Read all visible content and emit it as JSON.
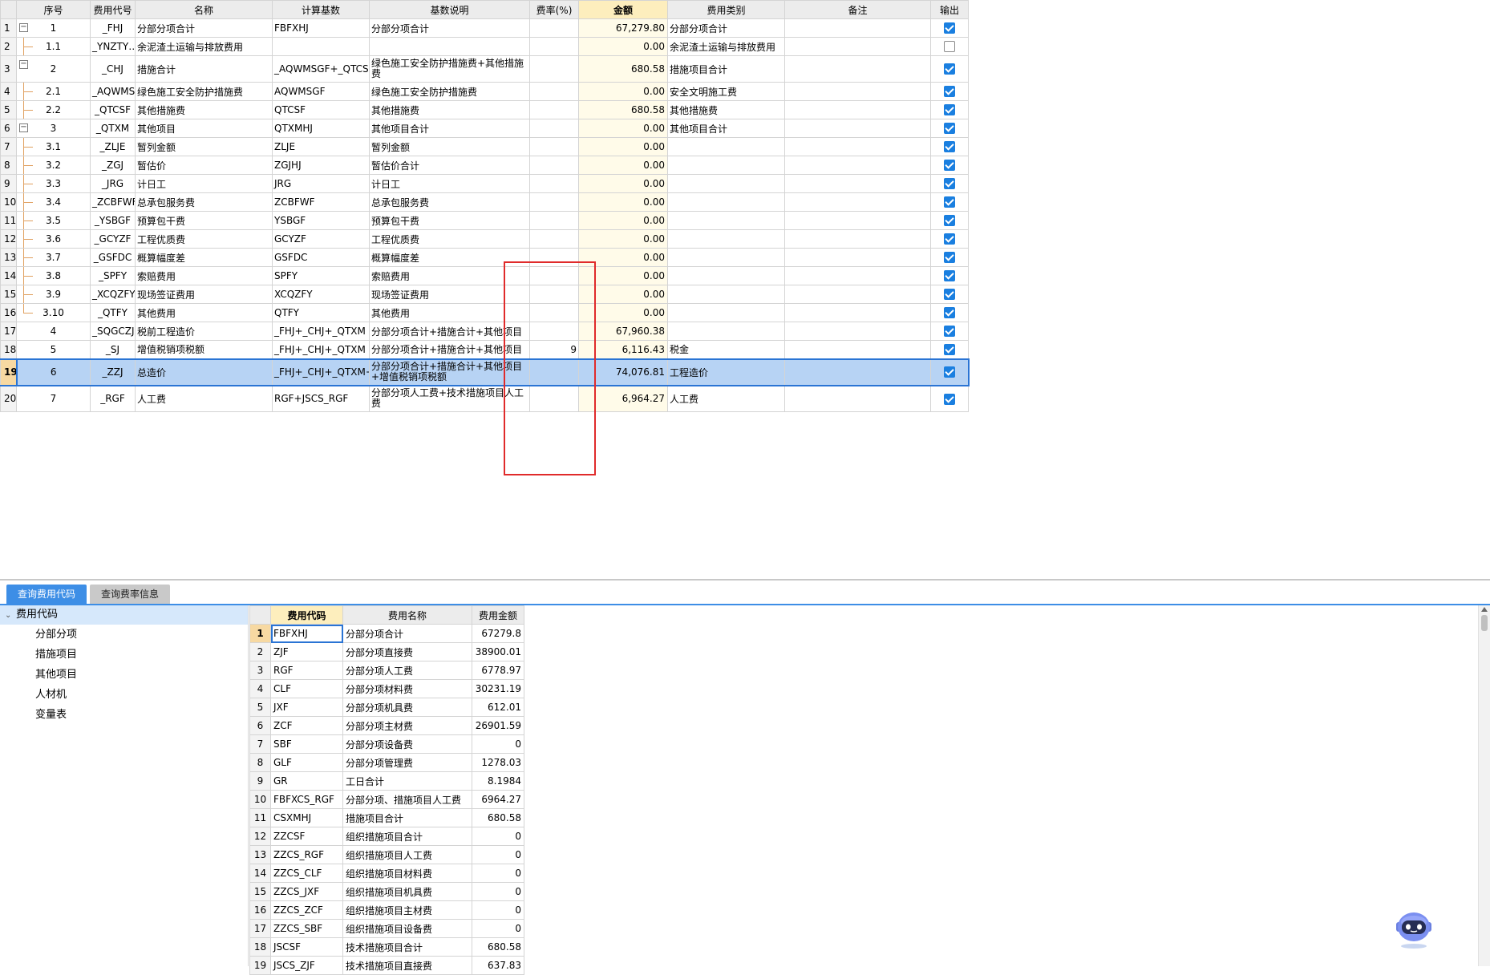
{
  "top_grid": {
    "headers": [
      "",
      "序号",
      "费用代号",
      "名称",
      "计算基数",
      "基数说明",
      "费率(%)",
      "金额",
      "费用类别",
      "备注",
      "输出"
    ],
    "rows": [
      {
        "rn": "1",
        "seq": "1",
        "code": "_FHJ",
        "name": "分部分项合计",
        "base": "FBFXHJ",
        "base_desc": "分部分项合计",
        "rate": "",
        "amount": "67,279.80",
        "category": "分部分项合计",
        "remark": "",
        "out": true,
        "tree": "expand"
      },
      {
        "rn": "2",
        "seq": "1.1",
        "code": "_YNZTY…",
        "name": "余泥渣土运输与排放费用",
        "base": "",
        "base_desc": "",
        "rate": "",
        "amount": "0.00",
        "category": "余泥渣土运输与排放费用",
        "remark": "",
        "out": false,
        "tree": "child"
      },
      {
        "rn": "3",
        "seq": "2",
        "code": "_CHJ",
        "name": "措施合计",
        "base": "_AQWMSGF+_QTCSF",
        "base_desc": "绿色施工安全防护措施费+其他措施费",
        "rate": "",
        "amount": "680.58",
        "category": "措施项目合计",
        "remark": "",
        "out": true,
        "tree": "expand",
        "tall": true
      },
      {
        "rn": "4",
        "seq": "2.1",
        "code": "_AQWMSGF",
        "name": "绿色施工安全防护措施费",
        "base": "AQWMSGF",
        "base_desc": "绿色施工安全防护措施费",
        "rate": "",
        "amount": "0.00",
        "category": "安全文明施工费",
        "remark": "",
        "out": true,
        "tree": "child"
      },
      {
        "rn": "5",
        "seq": "2.2",
        "code": "_QTCSF",
        "name": "其他措施费",
        "base": "QTCSF",
        "base_desc": "其他措施费",
        "rate": "",
        "amount": "680.58",
        "category": "其他措施费",
        "remark": "",
        "out": true,
        "tree": "child"
      },
      {
        "rn": "6",
        "seq": "3",
        "code": "_QTXM",
        "name": "其他项目",
        "base": "QTXMHJ",
        "base_desc": "其他项目合计",
        "rate": "",
        "amount": "0.00",
        "category": "其他项目合计",
        "remark": "",
        "out": true,
        "tree": "expand"
      },
      {
        "rn": "7",
        "seq": "3.1",
        "code": "_ZLJE",
        "name": "暂列金额",
        "base": "ZLJE",
        "base_desc": "暂列金额",
        "rate": "",
        "amount": "0.00",
        "category": "",
        "remark": "",
        "out": true,
        "tree": "child"
      },
      {
        "rn": "8",
        "seq": "3.2",
        "code": "_ZGJ",
        "name": "暂估价",
        "base": "ZGJHJ",
        "base_desc": "暂估价合计",
        "rate": "",
        "amount": "0.00",
        "category": "",
        "remark": "",
        "out": true,
        "tree": "child"
      },
      {
        "rn": "9",
        "seq": "3.3",
        "code": "_JRG",
        "name": "计日工",
        "base": "JRG",
        "base_desc": "计日工",
        "rate": "",
        "amount": "0.00",
        "category": "",
        "remark": "",
        "out": true,
        "tree": "child"
      },
      {
        "rn": "10",
        "seq": "3.4",
        "code": "_ZCBFWF",
        "name": "总承包服务费",
        "base": "ZCBFWF",
        "base_desc": "总承包服务费",
        "rate": "",
        "amount": "0.00",
        "category": "",
        "remark": "",
        "out": true,
        "tree": "child"
      },
      {
        "rn": "11",
        "seq": "3.5",
        "code": "_YSBGF",
        "name": "预算包干费",
        "base": "YSBGF",
        "base_desc": "预算包干费",
        "rate": "",
        "amount": "0.00",
        "category": "",
        "remark": "",
        "out": true,
        "tree": "child"
      },
      {
        "rn": "12",
        "seq": "3.6",
        "code": "_GCYZF",
        "name": "工程优质费",
        "base": "GCYZF",
        "base_desc": "工程优质费",
        "rate": "",
        "amount": "0.00",
        "category": "",
        "remark": "",
        "out": true,
        "tree": "child"
      },
      {
        "rn": "13",
        "seq": "3.7",
        "code": "_GSFDC",
        "name": "概算幅度差",
        "base": "GSFDC",
        "base_desc": "概算幅度差",
        "rate": "",
        "amount": "0.00",
        "category": "",
        "remark": "",
        "out": true,
        "tree": "child"
      },
      {
        "rn": "14",
        "seq": "3.8",
        "code": "_SPFY",
        "name": "索赔费用",
        "base": "SPFY",
        "base_desc": "索赔费用",
        "rate": "",
        "amount": "0.00",
        "category": "",
        "remark": "",
        "out": true,
        "tree": "child"
      },
      {
        "rn": "15",
        "seq": "3.9",
        "code": "_XCQZFY",
        "name": "现场签证费用",
        "base": "XCQZFY",
        "base_desc": "现场签证费用",
        "rate": "",
        "amount": "0.00",
        "category": "",
        "remark": "",
        "out": true,
        "tree": "child"
      },
      {
        "rn": "16",
        "seq": "3.10",
        "code": "_QTFY",
        "name": "其他费用",
        "base": "QTFY",
        "base_desc": "其他费用",
        "rate": "",
        "amount": "0.00",
        "category": "",
        "remark": "",
        "out": true,
        "tree": "last"
      },
      {
        "rn": "17",
        "seq": "4",
        "code": "_SQGCZJ",
        "name": "税前工程造价",
        "base": "_FHJ+_CHJ+_QTXM",
        "base_desc": "分部分项合计+措施合计+其他项目",
        "rate": "",
        "amount": "67,960.38",
        "category": "",
        "remark": "",
        "out": true,
        "tree": "none"
      },
      {
        "rn": "18",
        "seq": "5",
        "code": "_SJ",
        "name": "增值税销项税额",
        "base": "_FHJ+_CHJ+_QTXM",
        "base_desc": "分部分项合计+措施合计+其他项目",
        "rate": "9",
        "amount": "6,116.43",
        "category": "税金",
        "remark": "",
        "out": true,
        "tree": "none"
      },
      {
        "rn": "19",
        "seq": "6",
        "code": "_ZZJ",
        "name": "总造价",
        "base": "_FHJ+_CHJ+_QTXM+_SJ",
        "base_desc": "分部分项合计+措施合计+其他项目+增值税销项税额",
        "rate": "",
        "amount": "74,076.81",
        "category": "工程造价",
        "remark": "",
        "out": true,
        "tree": "none",
        "tall": true,
        "selected": true
      },
      {
        "rn": "20",
        "seq": "7",
        "code": "_RGF",
        "name": "人工费",
        "base": "RGF+JSCS_RGF",
        "base_desc": "分部分项人工费+技术措施项目人工费",
        "rate": "",
        "amount": "6,964.27",
        "category": "人工费",
        "remark": "",
        "out": true,
        "tree": "none",
        "tall": true
      }
    ]
  },
  "bottom": {
    "tabs": [
      "查询费用代码",
      "查询费率信息"
    ],
    "tree": {
      "root": "费用代码",
      "children": [
        "分部分项",
        "措施项目",
        "其他项目",
        "人材机",
        "变量表"
      ]
    },
    "code_headers": [
      "",
      "费用代码",
      "费用名称",
      "费用金额"
    ],
    "code_rows": [
      [
        "1",
        "FBFXHJ",
        "分部分项合计",
        "67279.8"
      ],
      [
        "2",
        "ZJF",
        "分部分项直接费",
        "38900.01"
      ],
      [
        "3",
        "RGF",
        "分部分项人工费",
        "6778.97"
      ],
      [
        "4",
        "CLF",
        "分部分项材料费",
        "30231.19"
      ],
      [
        "5",
        "JXF",
        "分部分项机具费",
        "612.01"
      ],
      [
        "6",
        "ZCF",
        "分部分项主材费",
        "26901.59"
      ],
      [
        "7",
        "SBF",
        "分部分项设备费",
        "0"
      ],
      [
        "8",
        "GLF",
        "分部分项管理费",
        "1278.03"
      ],
      [
        "9",
        "GR",
        "工日合计",
        "8.1984"
      ],
      [
        "10",
        "FBFXCS_RGF",
        "分部分项、措施项目人工费",
        "6964.27"
      ],
      [
        "11",
        "CSXMHJ",
        "措施项目合计",
        "680.58"
      ],
      [
        "12",
        "ZZCSF",
        "组织措施项目合计",
        "0"
      ],
      [
        "13",
        "ZZCS_RGF",
        "组织措施项目人工费",
        "0"
      ],
      [
        "14",
        "ZZCS_CLF",
        "组织措施项目材料费",
        "0"
      ],
      [
        "15",
        "ZZCS_JXF",
        "组织措施项目机具费",
        "0"
      ],
      [
        "16",
        "ZZCS_ZCF",
        "组织措施项目主材费",
        "0"
      ],
      [
        "17",
        "ZZCS_SBF",
        "组织措施项目设备费",
        "0"
      ],
      [
        "18",
        "JSCSF",
        "技术措施项目合计",
        "680.58"
      ],
      [
        "19",
        "JSCS_ZJF",
        "技术措施项目直接费",
        "637.83"
      ]
    ]
  },
  "icons": {
    "assistant": "robot-assistant-icon",
    "expand": "tree-collapse-icon",
    "checkbox": "checkbox-icon"
  },
  "colors": {
    "accent": "#3d8ee6",
    "selection": "#b7d3f4",
    "amount_header": "#fdeebd",
    "highlight_box": "#e02b2b"
  }
}
